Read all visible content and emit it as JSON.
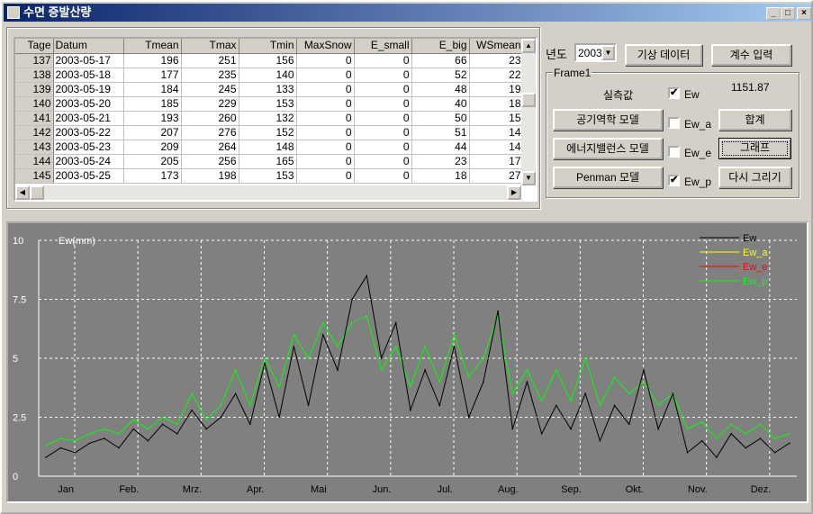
{
  "window": {
    "title": "수면 증발산량",
    "controls": [
      "_",
      "□",
      "×"
    ]
  },
  "table": {
    "columns": [
      "Tage",
      "Datum",
      "Tmean",
      "Tmax",
      "Tmin",
      "MaxSnow",
      "E_small",
      "E_big",
      "WSmean"
    ],
    "rows": [
      [
        "137",
        "2003-05-17",
        "196",
        "251",
        "156",
        "0",
        "0",
        "66",
        "23"
      ],
      [
        "138",
        "2003-05-18",
        "177",
        "235",
        "140",
        "0",
        "0",
        "52",
        "22"
      ],
      [
        "139",
        "2003-05-19",
        "184",
        "245",
        "133",
        "0",
        "0",
        "48",
        "19"
      ],
      [
        "140",
        "2003-05-20",
        "185",
        "229",
        "153",
        "0",
        "0",
        "40",
        "18"
      ],
      [
        "141",
        "2003-05-21",
        "193",
        "260",
        "132",
        "0",
        "0",
        "50",
        "15"
      ],
      [
        "142",
        "2003-05-22",
        "207",
        "276",
        "152",
        "0",
        "0",
        "51",
        "14"
      ],
      [
        "143",
        "2003-05-23",
        "209",
        "264",
        "148",
        "0",
        "0",
        "44",
        "14"
      ],
      [
        "144",
        "2003-05-24",
        "205",
        "256",
        "165",
        "0",
        "0",
        "23",
        "17"
      ],
      [
        "145",
        "2003-05-25",
        "173",
        "198",
        "153",
        "0",
        "0",
        "18",
        "27"
      ]
    ]
  },
  "controls": {
    "year_label": "년도",
    "year_value": "2003",
    "weather_button": "기상 데이터",
    "coef_button": "계수 입력",
    "frame_title": "Frame1",
    "measured_label": "실측값",
    "total_value": "1151.87",
    "aero_button": "공기역학 모델",
    "energy_button": "에너지밸런스 모델",
    "penman_button": "Penman 모델",
    "sum_button": "합계",
    "graph_button": "그래프",
    "redraw_button": "다시 그리기",
    "checks": [
      {
        "label": "Ew",
        "checked": true
      },
      {
        "label": "Ew_a",
        "checked": false
      },
      {
        "label": "Ew_e",
        "checked": false
      },
      {
        "label": "Ew_p",
        "checked": true
      }
    ]
  },
  "chart_data": {
    "type": "line",
    "ylabel": "Ew(mm)",
    "ylim": [
      0,
      10
    ],
    "yticks": [
      "0",
      "2.5",
      "5",
      "7.5",
      "10"
    ],
    "xticks": [
      "Jan",
      "Feb.",
      "Mrz.",
      "Apr.",
      "Mai",
      "Jun.",
      "Jul.",
      "Aug.",
      "Sep.",
      "Okt.",
      "Nov.",
      "Dez."
    ],
    "grid": true,
    "legend_position": "top-right",
    "x_unit": "week",
    "series": [
      {
        "name": "Ew",
        "color": "#000000",
        "values": [
          0.8,
          1.2,
          1.0,
          1.4,
          1.6,
          1.2,
          2.0,
          1.5,
          2.2,
          1.8,
          2.8,
          2.0,
          2.5,
          3.5,
          2.2,
          4.8,
          2.5,
          5.5,
          3.0,
          6.0,
          4.5,
          7.5,
          8.5,
          5.0,
          6.5,
          2.8,
          4.5,
          3.0,
          5.5,
          2.5,
          4.0,
          7.0,
          2.0,
          4.0,
          1.8,
          3.0,
          2.0,
          3.5,
          1.5,
          3.0,
          2.2,
          4.5,
          2.0,
          3.5,
          1.0,
          1.5,
          0.8,
          1.8,
          1.2,
          1.6,
          1.0,
          1.4
        ]
      },
      {
        "name": "Ew_a",
        "color": "#ffff00",
        "values": []
      },
      {
        "name": "Ew_e",
        "color": "#ff0000",
        "values": []
      },
      {
        "name": "Ew_p",
        "color": "#00ff00",
        "values": [
          1.3,
          1.6,
          1.5,
          1.8,
          2.0,
          1.8,
          2.4,
          2.0,
          2.5,
          2.2,
          3.5,
          2.4,
          3.0,
          4.5,
          3.0,
          5.0,
          3.8,
          6.0,
          5.0,
          6.5,
          5.5,
          6.5,
          6.8,
          4.5,
          5.5,
          3.8,
          5.5,
          4.0,
          6.0,
          4.2,
          5.0,
          6.8,
          3.5,
          4.5,
          3.2,
          4.5,
          3.2,
          5.0,
          3.0,
          4.2,
          3.5,
          4.0,
          3.0,
          3.5,
          2.0,
          2.3,
          1.6,
          2.2,
          1.8,
          2.2,
          1.6,
          1.8
        ]
      }
    ]
  }
}
